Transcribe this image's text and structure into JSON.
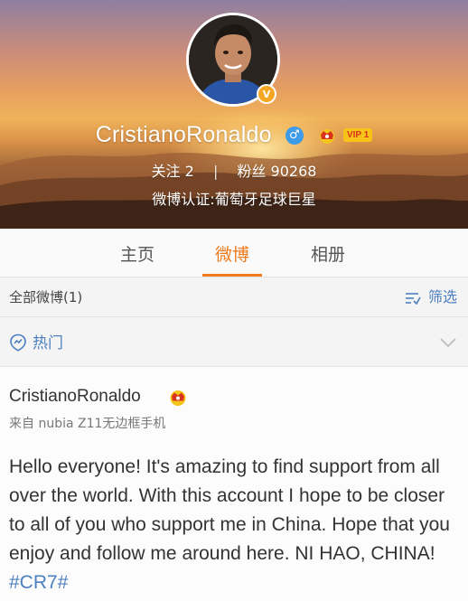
{
  "profile": {
    "name": "CristianoRonaldo",
    "gender_symbol": "♂",
    "vip_label": "VIP 1",
    "verify_badge": "V",
    "follow_label": "关注",
    "follow_count": "2",
    "separator": "|",
    "fans_label": "粉丝",
    "fans_count": "90268",
    "verification": "微博认证:葡萄牙足球巨星"
  },
  "tabs": [
    {
      "label": "主页",
      "active": false
    },
    {
      "label": "微博",
      "active": true
    },
    {
      "label": "相册",
      "active": false
    }
  ],
  "filter": {
    "all_label": "全部微博(1)",
    "filter_label": "筛选"
  },
  "hot": {
    "label": "热门"
  },
  "post": {
    "author": "CristianoRonaldo",
    "source": "来自 nubia Z11无边框手机",
    "text": "Hello everyone! It's amazing to find support from all over the world. With this account I hope to be closer to all of you who support me in China. Hope that you enjoy and follow me around here. NI HAO, CHINA! ",
    "hashtag": "#CR7#"
  },
  "colors": {
    "accent_orange": "#f07b1d",
    "link_blue": "#4c7fbf",
    "vip_gold": "#f7c21a",
    "gender_blue": "#3d9be8"
  },
  "icons": {
    "gender": "male-symbol-icon",
    "crown": "crown-icon",
    "verify": "verified-badge-icon",
    "filter": "filter-icon",
    "hot": "hot-location-icon",
    "expand": "chevron-down-icon"
  }
}
